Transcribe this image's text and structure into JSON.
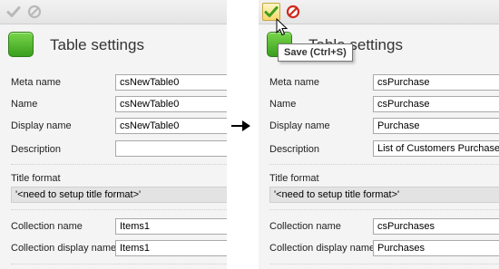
{
  "before": {
    "toolbar": {
      "accept_icon": "checkmark-icon",
      "cancel_icon": "cancel-icon"
    },
    "title": "Table settings",
    "labels": {
      "meta_name": "Meta name",
      "name": "Name",
      "display_name": "Display name",
      "description": "Description",
      "title_format": "Title format",
      "collection_name": "Collection name",
      "collection_display_name": "Collection display name"
    },
    "values": {
      "meta_name": "csNewTable0",
      "name": "csNewTable0",
      "display_name": "csNewTable0",
      "description": "",
      "title_format": "'<need to setup title format>'",
      "collection_name": "Items1",
      "collection_display_name": "Items1"
    }
  },
  "after": {
    "toolbar": {
      "accept_icon": "checkmark-icon",
      "cancel_icon": "cancel-icon"
    },
    "tooltip": "Save (Ctrl+S)",
    "title": "Table settings",
    "labels": {
      "meta_name": "Meta name",
      "name": "Name",
      "display_name": "Display name",
      "description": "Description",
      "title_format": "Title format",
      "collection_name": "Collection name",
      "collection_display_name": "Collection display name"
    },
    "values": {
      "meta_name": "csPurchase",
      "name": "csPurchase",
      "display_name": "Purchase",
      "description": "List of Customers Purchases",
      "title_format": "'<need to setup title format>'",
      "collection_name": "csPurchases",
      "collection_display_name": "Purchases"
    }
  },
  "colors": {
    "accent_green": "#4caf2a",
    "cancel_red": "#d0281c",
    "tooltip_border": "#767676"
  }
}
